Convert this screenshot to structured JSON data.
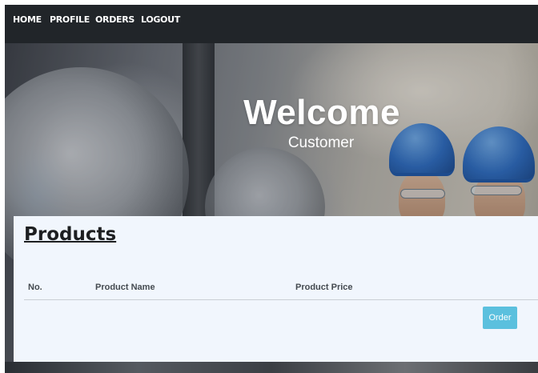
{
  "nav": {
    "items": [
      {
        "label": "HOME"
      },
      {
        "label": "PROFILE"
      },
      {
        "label": "ORDERS"
      },
      {
        "label": "LOGOUT"
      }
    ]
  },
  "hero": {
    "title": "Welcome",
    "subtitle": "Customer"
  },
  "products": {
    "title": "Products",
    "columns": [
      "No.",
      "Product Name",
      "Product Price"
    ],
    "order_button": "Order"
  },
  "colors": {
    "navbar": "#212529",
    "panel_background": "#f1f6fd",
    "order_button": "#5bc0de",
    "helmet": "#2d6cc0"
  }
}
